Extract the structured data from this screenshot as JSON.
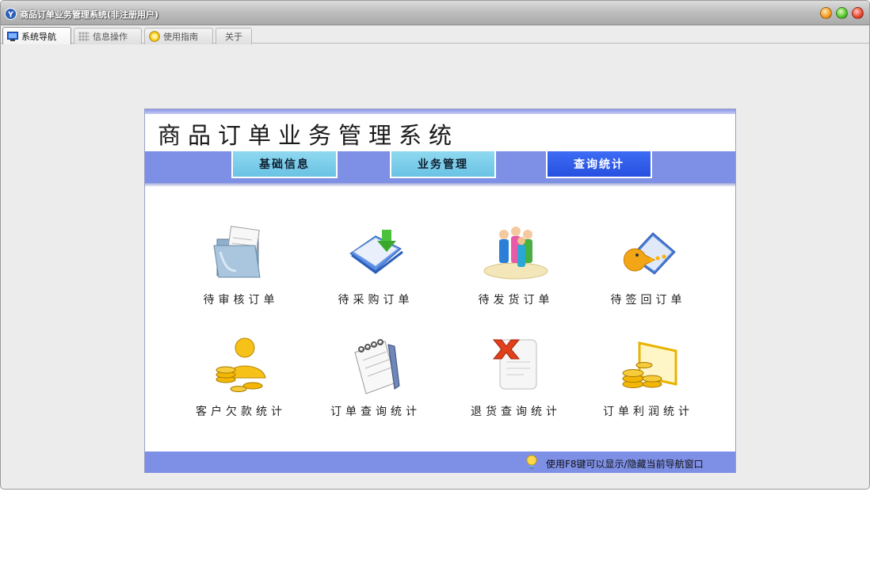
{
  "window": {
    "title": "商品订单业务管理系统(非注册用户)",
    "app_icon": "app-logo-icon",
    "controls": [
      "minimize-icon",
      "maximize-icon",
      "close-icon"
    ]
  },
  "tabs": [
    {
      "label": "系统导航",
      "icon": "monitor-icon",
      "active": true
    },
    {
      "label": "信息操作",
      "icon": "grid-icon",
      "active": false
    },
    {
      "label": "使用指南",
      "icon": "lightbulb-icon",
      "active": false
    },
    {
      "label": "关于",
      "icon": "",
      "active": false
    }
  ],
  "panel": {
    "system_title": "商品订单业务管理系统",
    "menu": [
      {
        "label": "基础信息",
        "active": false
      },
      {
        "label": "业务管理",
        "active": false
      },
      {
        "label": "查询统计",
        "active": true
      }
    ],
    "items": [
      {
        "label": "待审核订单",
        "icon": "folder-document-icon"
      },
      {
        "label": "待采购订单",
        "icon": "download-document-icon"
      },
      {
        "label": "待发货订单",
        "icon": "people-group-icon"
      },
      {
        "label": "待签回订单",
        "icon": "pacman-folder-icon"
      },
      {
        "label": "客户欠款统计",
        "icon": "gold-coins-person-icon"
      },
      {
        "label": "订单查询统计",
        "icon": "notepad-pen-icon"
      },
      {
        "label": "退货查询统计",
        "icon": "document-delete-icon"
      },
      {
        "label": "订单利润统计",
        "icon": "coins-monitor-icon"
      }
    ],
    "footer_hint": "使用F8键可以显示/隐藏当前导航窗口",
    "footer_icon": "lightbulb-icon"
  },
  "colors": {
    "menubar": "#7e8fe6",
    "menu_button": "#6ac2e4",
    "menu_button_active": "#3560ee",
    "window_bg": "#ececec"
  }
}
